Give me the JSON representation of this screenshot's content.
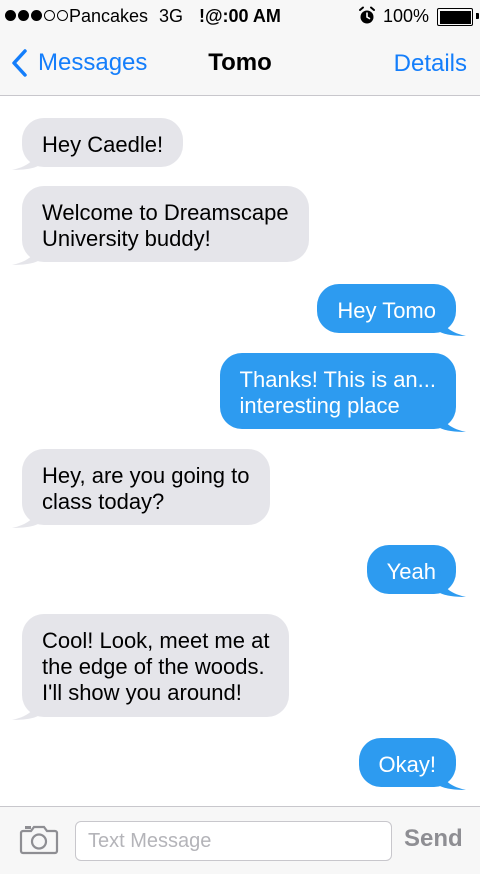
{
  "status_bar": {
    "carrier": "Pancakes",
    "network": "3G",
    "time": "!@:00 AM",
    "battery": "100%",
    "signal_bars_filled": 3,
    "signal_bars_total": 5
  },
  "nav": {
    "back_label": "Messages",
    "title": "Tomo",
    "details_label": "Details"
  },
  "messages": [
    {
      "sender": "incoming",
      "text": "Hey Caedle!"
    },
    {
      "sender": "incoming",
      "text": "Welcome to Dreamscape\nUniversity buddy!"
    },
    {
      "sender": "outgoing",
      "text": "Hey Tomo"
    },
    {
      "sender": "outgoing",
      "text": "Thanks! This is an...\ninteresting place"
    },
    {
      "sender": "incoming",
      "text": "Hey, are you going to\nclass today?"
    },
    {
      "sender": "outgoing",
      "text": "Yeah"
    },
    {
      "sender": "incoming",
      "text": "Cool! Look, meet me at\nthe edge of the woods.\nI'll show you around!"
    },
    {
      "sender": "outgoing",
      "text": "Okay!"
    }
  ],
  "input_bar": {
    "placeholder": "Text Message",
    "send_label": "Send"
  },
  "colors": {
    "ios_blue": "#147efb",
    "outgoing_bubble": "#2d9bf0",
    "incoming_bubble": "#e5e5ea",
    "send_disabled": "#8e8e93"
  },
  "icons": [
    "back-chevron-icon",
    "alarm-icon",
    "battery-icon",
    "camera-icon"
  ]
}
